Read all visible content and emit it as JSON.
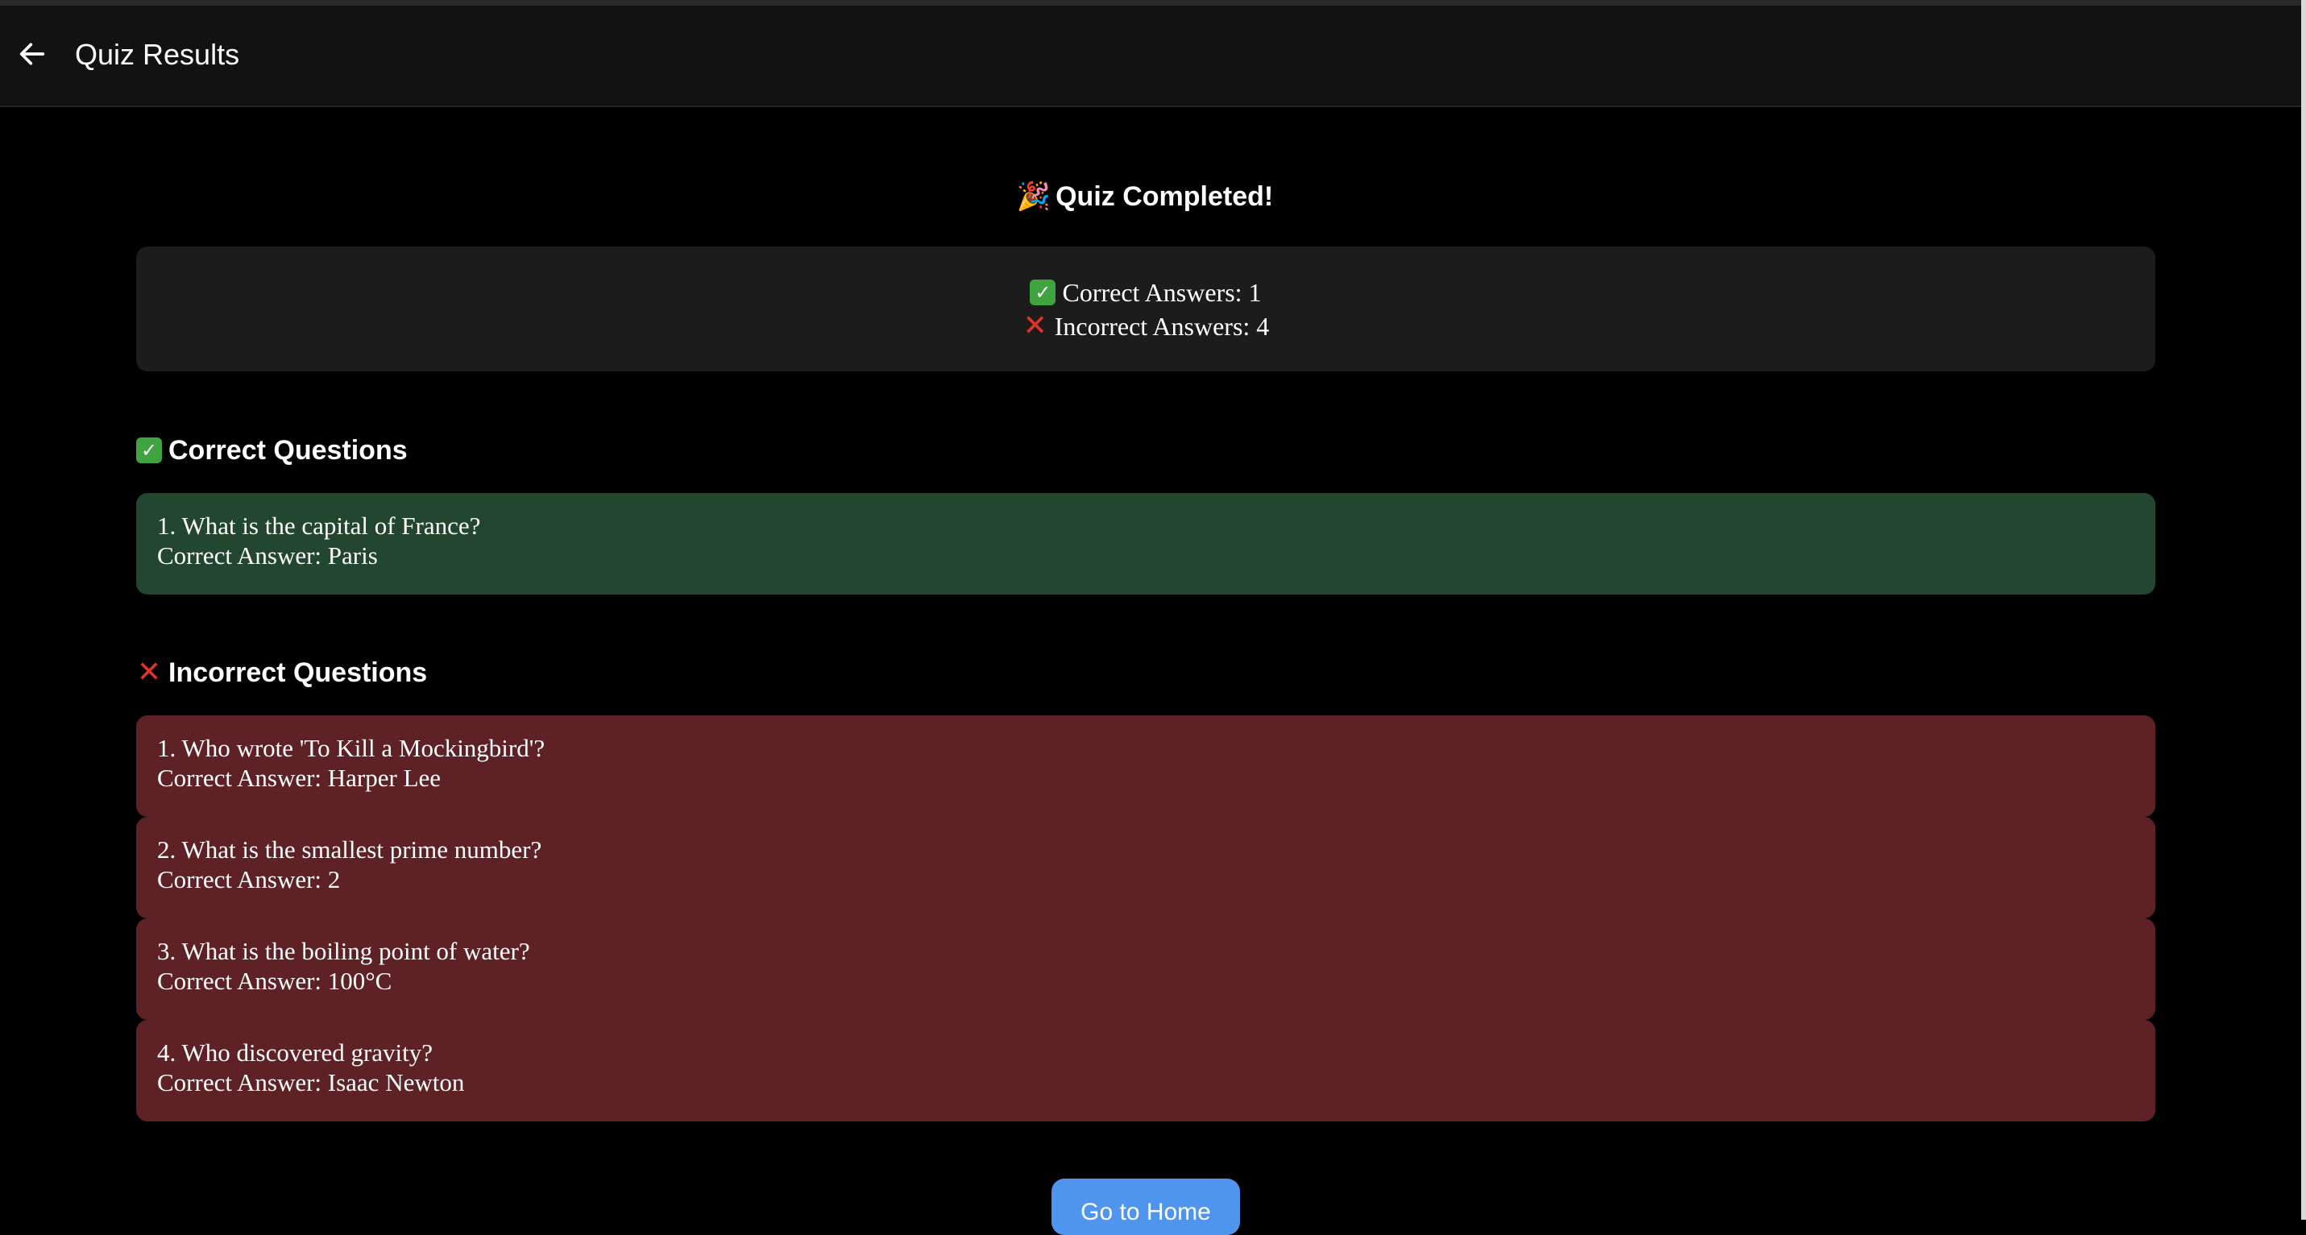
{
  "header": {
    "back_icon": "arrow-left-icon",
    "title": "Quiz Results"
  },
  "result": {
    "title_emoji": "🎉",
    "title": "Quiz Completed!",
    "correct_line": "Correct Answers: 1",
    "incorrect_line": "Incorrect Answers: 4",
    "correct_icon": "check-mark-button-icon",
    "incorrect_icon": "cross-mark-icon"
  },
  "correct_section": {
    "heading": "Correct Questions",
    "items": [
      {
        "question": "1. What is the capital of France?",
        "answer": "Correct Answer: Paris"
      }
    ]
  },
  "incorrect_section": {
    "heading": "Incorrect Questions",
    "items": [
      {
        "question": "1. Who wrote 'To Kill a Mockingbird'?",
        "answer": "Correct Answer: Harper Lee"
      },
      {
        "question": "2. What is the smallest prime number?",
        "answer": "Correct Answer: 2"
      },
      {
        "question": "3. What is the boiling point of water?",
        "answer": "Correct Answer: 100°C"
      },
      {
        "question": "4. Who discovered gravity?",
        "answer": "Correct Answer: Isaac Newton"
      }
    ]
  },
  "footer": {
    "home_button_label": "Go to Home"
  },
  "colors": {
    "background": "#000000",
    "header": "#121212",
    "summary_card": "#1c1c1c",
    "correct_card": "#23462f",
    "incorrect_card": "#5e2226",
    "button": "#4f95ee",
    "check": "#3fa33f",
    "cross": "#e0342a"
  }
}
